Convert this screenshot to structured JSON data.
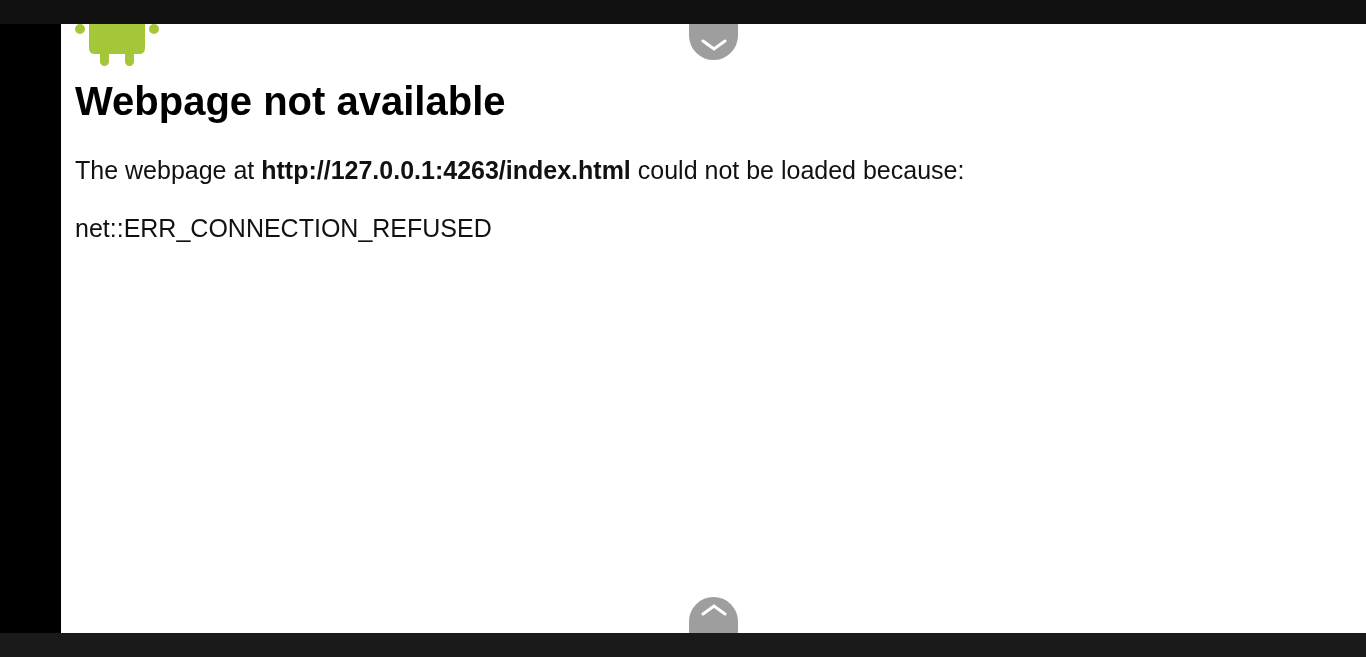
{
  "page": {
    "heading": "Webpage not available",
    "message": "The webpage at **http://127.0.0.1:4263/index.html** could not be loaded because:",
    "error_code": "net::ERR_CONNECTION_REFUSED"
  }
}
